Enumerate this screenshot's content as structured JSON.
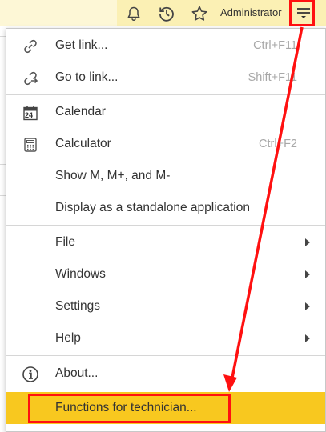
{
  "topbar": {
    "user": "Administrator",
    "icons": [
      "bell-icon",
      "history-icon",
      "star-icon",
      "hamburger-menu-icon"
    ]
  },
  "menu": {
    "groups": [
      [
        {
          "label": "Get link...",
          "shortcut": "Ctrl+F11",
          "icon": "link-icon"
        },
        {
          "label": "Go to link...",
          "shortcut": "Shift+F11",
          "icon": "go-to-link-icon"
        }
      ],
      [
        {
          "label": "Calendar",
          "shortcut": "",
          "icon": "calendar-icon"
        },
        {
          "label": "Calculator",
          "shortcut": "Ctrl+F2",
          "icon": "calculator-icon"
        },
        {
          "label": "Show M, M+, and M-",
          "shortcut": ""
        },
        {
          "label": "Display as a standalone application",
          "shortcut": ""
        }
      ],
      [
        {
          "label": "File",
          "submenu": true
        },
        {
          "label": "Windows",
          "submenu": true
        },
        {
          "label": "Settings",
          "submenu": true
        },
        {
          "label": "Help",
          "submenu": true
        }
      ],
      [
        {
          "label": "About...",
          "icon": "info-icon"
        }
      ],
      [
        {
          "label": "Functions for technician...",
          "highlighted": true
        }
      ]
    ],
    "calendar_day": "24"
  },
  "colors": {
    "topbar": "#fbf0b4",
    "highlight": "#f8c81f",
    "annotation": "#ff1010"
  }
}
